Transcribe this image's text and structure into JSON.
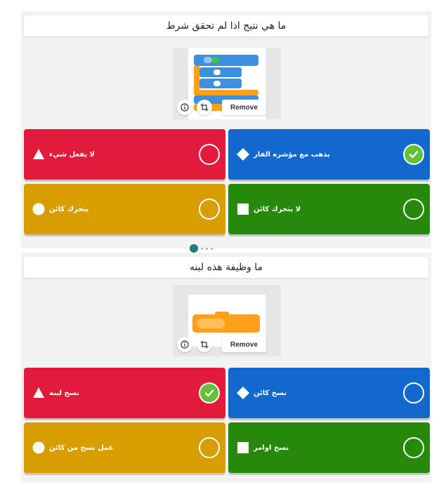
{
  "media": {
    "remove_label": "Remove"
  },
  "colors": {
    "red": "#e21b3c",
    "blue": "#1368ce",
    "yellow": "#d89e00",
    "green": "#26890c",
    "correct": "#66bf39"
  },
  "questions": [
    {
      "title": "ما هي نتيج  اذا لم تحقق شرط",
      "answers": [
        {
          "label": "لا يفعل شيء",
          "shape": "triangle-icon",
          "color": "red",
          "correct": false
        },
        {
          "label": "يذهب مع مؤشره الفار",
          "shape": "diamond-icon",
          "color": "blue",
          "correct": true
        },
        {
          "label": "يتحرك كائن",
          "shape": "circle-icon",
          "color": "yellow",
          "correct": false
        },
        {
          "label": "لا يتحرك كائن",
          "shape": "square-icon",
          "color": "green",
          "correct": false
        }
      ]
    },
    {
      "title": "ما وظيفة هذه لبنه",
      "answers": [
        {
          "label": "نسخ لبنه",
          "shape": "triangle-icon",
          "color": "red",
          "correct": true
        },
        {
          "label": "نسخ كائن",
          "shape": "diamond-icon",
          "color": "blue",
          "correct": false
        },
        {
          "label": "عمل نسخ من كائن",
          "shape": "circle-icon",
          "color": "yellow",
          "correct": false
        },
        {
          "label": "نسخ اوامر",
          "shape": "square-icon",
          "color": "green",
          "correct": false
        }
      ]
    }
  ]
}
